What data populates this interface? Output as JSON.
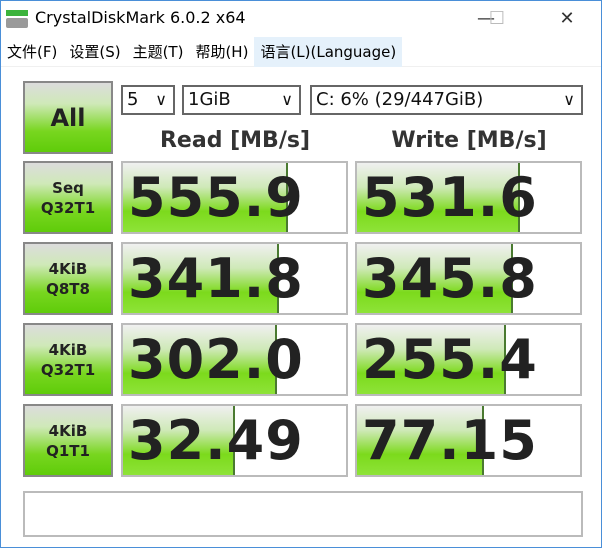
{
  "window": {
    "title": "CrystalDiskMark 6.0.2 x64",
    "minimize": "—",
    "maximize": "☐",
    "close": "✕"
  },
  "menu": [
    "文件(F)",
    "设置(S)",
    "主题(T)",
    "帮助(H)",
    "语言(L)(Language)"
  ],
  "controls": {
    "all_label": "All",
    "count": "5",
    "size": "1GiB",
    "drive": "C: 6% (29/447GiB)",
    "chevron": "∨"
  },
  "headers": {
    "read": "Read [MB/s]",
    "write": "Write [MB/s]"
  },
  "rows": [
    {
      "label1": "Seq",
      "label2": "Q32T1",
      "read": "555.9",
      "write": "531.6",
      "read_fill": 0.74,
      "write_fill": 0.73
    },
    {
      "label1": "4KiB",
      "label2": "Q8T8",
      "read": "341.8",
      "write": "345.8",
      "read_fill": 0.7,
      "write_fill": 0.7
    },
    {
      "label1": "4KiB",
      "label2": "Q32T1",
      "read": "302.0",
      "write": "255.4",
      "read_fill": 0.69,
      "write_fill": 0.67
    },
    {
      "label1": "4KiB",
      "label2": "Q1T1",
      "read": "32.49",
      "write": "77.15",
      "read_fill": 0.5,
      "write_fill": 0.57
    }
  ],
  "comment": ""
}
